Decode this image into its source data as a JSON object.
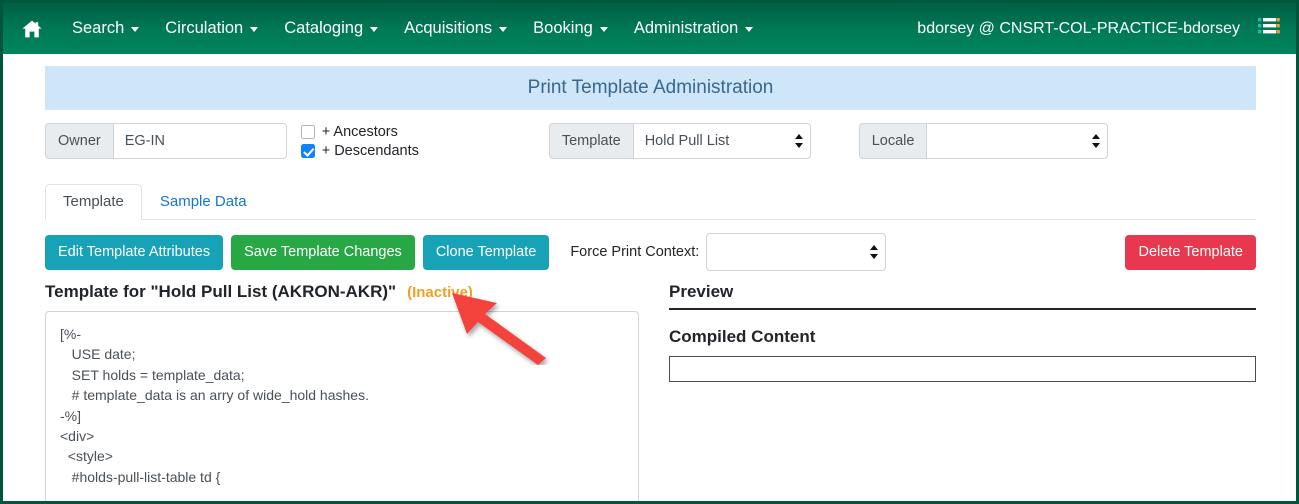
{
  "navbar": {
    "home_icon": "home-icon",
    "menu_icon": "list-menu-icon",
    "items": [
      {
        "label": "Search"
      },
      {
        "label": "Circulation"
      },
      {
        "label": "Cataloging"
      },
      {
        "label": "Acquisitions"
      },
      {
        "label": "Booking"
      },
      {
        "label": "Administration"
      }
    ],
    "user": "bdorsey @ CNSRT-COL-PRACTICE-bdorsey"
  },
  "banner": {
    "title": "Print Template Administration"
  },
  "filters": {
    "owner_label": "Owner",
    "owner_value": "EG-IN",
    "ancestors_label": "+ Ancestors",
    "ancestors_checked": false,
    "descendants_label": "+ Descendants",
    "descendants_checked": true,
    "template_label": "Template",
    "template_value": "Hold Pull List",
    "locale_label": "Locale",
    "locale_value": ""
  },
  "tabs": [
    {
      "label": "Template",
      "active": true
    },
    {
      "label": "Sample Data",
      "active": false
    }
  ],
  "actions": {
    "edit_attributes": "Edit Template Attributes",
    "save_changes": "Save Template Changes",
    "clone_template": "Clone Template",
    "force_print_context_label": "Force Print Context:",
    "force_print_context_value": "",
    "delete_template": "Delete Template"
  },
  "editor": {
    "heading": "Template for \"Hold Pull List (AKRON-AKR)\"",
    "status": "(Inactive)",
    "content": "[%-\n   USE date;\n   SET holds = template_data;\n   # template_data is an arry of wide_hold hashes.\n-%]\n<div>\n  <style>\n   #holds-pull-list-table td {"
  },
  "preview": {
    "title": "Preview",
    "compiled_content_label": "Compiled Content",
    "compiled_content_value": ""
  },
  "annotation": {
    "arrow_color": "#f4433c",
    "points_to": "(Inactive)"
  },
  "colors": {
    "navbar_green": "#00785a",
    "banner_blue": "#cfe5f8",
    "banner_text": "#38688e",
    "info": "#17a2b8",
    "success": "#28a745",
    "danger": "#e8384f",
    "status_orange": "#f0a022",
    "link_blue": "#1476d2",
    "frame_border": "#00563b"
  }
}
